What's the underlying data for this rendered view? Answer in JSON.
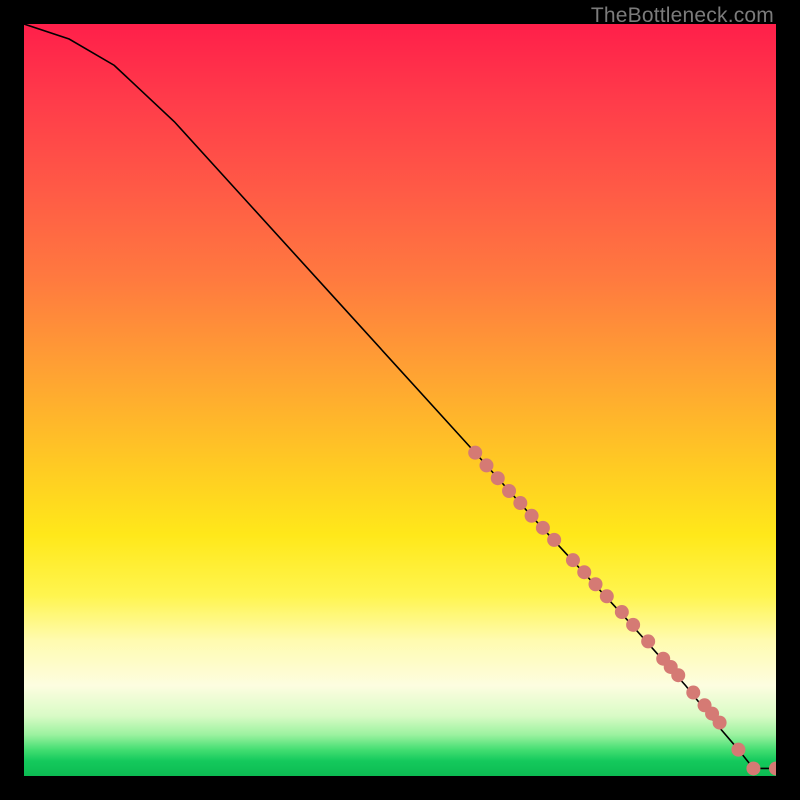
{
  "watermark": "TheBottleneck.com",
  "chart_data": {
    "type": "line",
    "title": "",
    "xlabel": "",
    "ylabel": "",
    "xlim": [
      0,
      100
    ],
    "ylim": [
      0,
      100
    ],
    "curve": {
      "x": [
        0,
        6,
        12,
        20,
        30,
        40,
        50,
        60,
        68,
        74,
        80,
        84,
        88,
        92,
        95,
        97,
        100
      ],
      "y": [
        100,
        98,
        94.5,
        87,
        76,
        65,
        54,
        43,
        34,
        27.5,
        21,
        16.5,
        12,
        7,
        3.5,
        1,
        1
      ]
    },
    "markers": {
      "x": [
        60.0,
        61.5,
        63.0,
        64.5,
        66.0,
        67.5,
        69.0,
        70.5,
        73.0,
        74.5,
        76.0,
        77.5,
        79.5,
        81.0,
        83.0,
        85.0,
        86.0,
        87.0,
        89.0,
        90.5,
        91.5,
        92.5,
        95.0,
        97.0,
        100.0
      ],
      "y": [
        43.0,
        41.3,
        39.6,
        37.9,
        36.3,
        34.6,
        33.0,
        31.4,
        28.7,
        27.1,
        25.5,
        23.9,
        21.8,
        20.1,
        17.9,
        15.6,
        14.5,
        13.4,
        11.1,
        9.4,
        8.3,
        7.1,
        3.5,
        1.0,
        1.0
      ]
    },
    "marker_color": "#d57a74",
    "line_color": "#000000"
  }
}
